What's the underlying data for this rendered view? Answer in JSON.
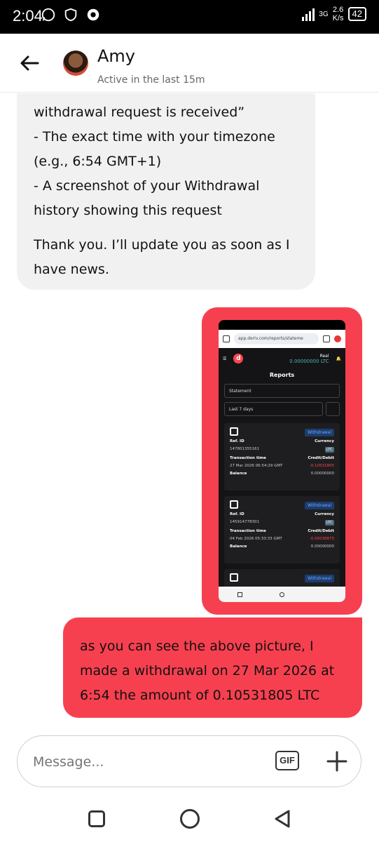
{
  "status_bar": {
    "time": "2:04",
    "net_speed_value": "2.6",
    "net_speed_unit": "K/s",
    "network_type": "3G",
    "battery": "42"
  },
  "header": {
    "contact_name": "Amy",
    "contact_status": "Active in the last 15m"
  },
  "messages": {
    "incoming": {
      "paragraph_1": "withdrawal request is received”\n- The exact time with your timezone (e.g., 6:54 GMT+1)\n- A screenshot of your Withdrawal history showing this request",
      "paragraph_2": "Thank you. I’ll update you as soon as I have news."
    },
    "outgoing_text": "as you can see the above picture, I made a withdrawal on 27 Mar 2026 at 6:54 the amount of 0.10531805 LTC"
  },
  "attachment": {
    "url": "app.deriv.com/reports/stateme",
    "account_type": "Real",
    "balance": "0.00000000 LTC",
    "page_title": "Reports",
    "dropdown_value": "Statement",
    "date_filter": "Last 7 days",
    "transactions": [
      {
        "type": "Withdrawal",
        "ref_label": "Ref. ID",
        "ref_id": "147801355161",
        "currency_label": "Currency",
        "currency": "LTC",
        "time_label": "Transaction time",
        "time": "27 Mar 2026 06:54:29 GMT",
        "credit_label": "Credit/Debit",
        "amount": "-0.10531805",
        "balance_label": "Balance",
        "balance": "0.00000000"
      },
      {
        "type": "Withdrawal",
        "ref_label": "Ref. ID",
        "ref_id": "145914778301",
        "currency_label": "Currency",
        "currency": "LTC",
        "time_label": "Transaction time",
        "time": "04 Feb 2026 05:33:33 GMT",
        "credit_label": "Credit/Debit",
        "amount": "-0.09236875",
        "balance_label": "Balance",
        "balance": "0.00000000"
      },
      {
        "type": "Withdrawal"
      }
    ]
  },
  "composer": {
    "placeholder": "Message...",
    "gif_label": "GIF"
  }
}
